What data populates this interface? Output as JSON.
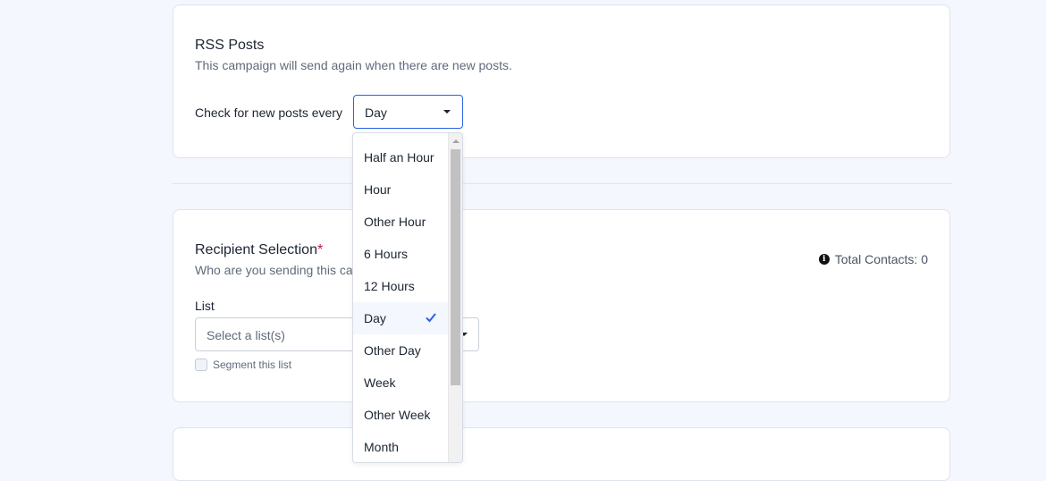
{
  "rss": {
    "title": "RSS Posts",
    "subtitle": "This campaign will send again when there are new posts.",
    "frequency_label": "Check for new posts every",
    "frequency_value": "Day"
  },
  "frequency_options": [
    {
      "label": "Half an Hour",
      "selected": false
    },
    {
      "label": "Hour",
      "selected": false
    },
    {
      "label": "Other Hour",
      "selected": false
    },
    {
      "label": "6 Hours",
      "selected": false
    },
    {
      "label": "12 Hours",
      "selected": false
    },
    {
      "label": "Day",
      "selected": true
    },
    {
      "label": "Other Day",
      "selected": false
    },
    {
      "label": "Week",
      "selected": false
    },
    {
      "label": "Other Week",
      "selected": false
    },
    {
      "label": "Month",
      "selected": false
    }
  ],
  "recipient": {
    "title": "Recipient Selection",
    "required_mark": "*",
    "subtitle": "Who are you sending this ca",
    "list_label": "List",
    "list_placeholder": "Select a list(s)",
    "segment_label": "Segment this list",
    "total_contacts": "Total Contacts: 0"
  },
  "colors": {
    "accent": "#2a62e6",
    "required": "#c0143c",
    "page_background": "#f4f7fd"
  },
  "icons": {
    "select_caret": "caret-down-icon",
    "selected_check": "check-icon",
    "info": "info-icon"
  }
}
